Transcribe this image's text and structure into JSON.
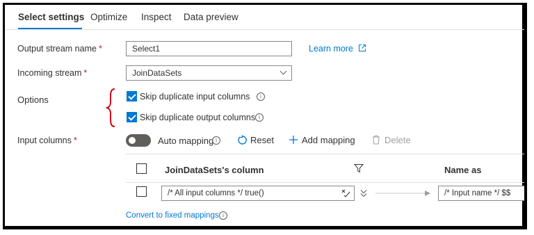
{
  "tabs": [
    {
      "label": "Select settings",
      "active": true
    },
    {
      "label": "Optimize"
    },
    {
      "label": "Inspect"
    },
    {
      "label": "Data preview"
    }
  ],
  "form": {
    "output_stream": {
      "label": "Output stream name",
      "required": "*",
      "value": "Select1"
    },
    "learn_more": "Learn more",
    "incoming_stream": {
      "label": "Incoming stream",
      "required": "*",
      "value": "JoinDataSets"
    },
    "options": {
      "label": "Options",
      "items": [
        {
          "label": "Skip duplicate input columns",
          "checked": true
        },
        {
          "label": "Skip duplicate output columns",
          "checked": true
        }
      ]
    },
    "input_columns": {
      "label": "Input columns",
      "required": "*"
    }
  },
  "toolbar": {
    "auto_mapping": "Auto mapping",
    "auto_mapping_on": false,
    "reset": "Reset",
    "add_mapping": "Add mapping",
    "delete": "Delete"
  },
  "table": {
    "col_source": "JoinDataSets's column",
    "col_name_as": "Name as",
    "row": {
      "source_expr": "/* All input columns */ true()",
      "name_expr": "/* Input name */ $$"
    }
  },
  "convert_link": "Convert to fixed mappings",
  "colors": {
    "accent": "#0078d4",
    "required": "#a4262c",
    "annotation": "#d0021b"
  }
}
